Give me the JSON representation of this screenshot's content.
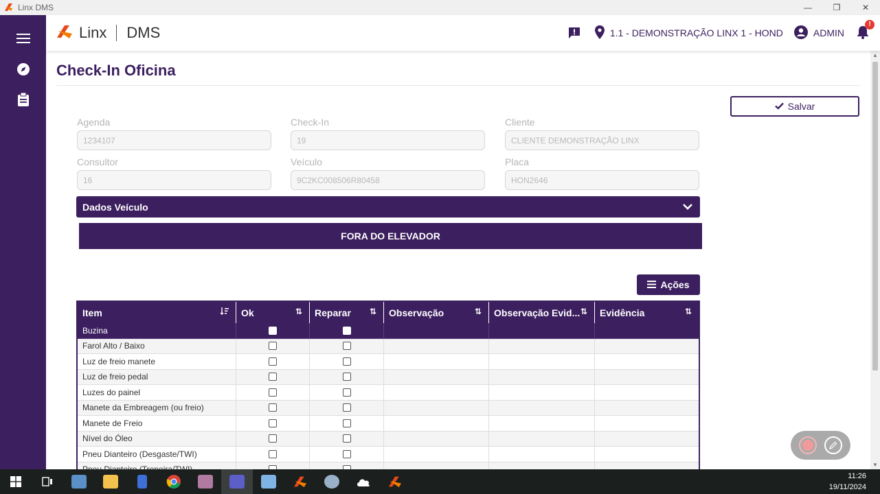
{
  "window": {
    "title": "Linx DMS",
    "controls": [
      "—",
      "❐",
      "✕"
    ]
  },
  "header": {
    "brand_name": "Linx",
    "brand_product": "DMS",
    "location": "1.1 - DEMONSTRAÇÃO LINX 1 - HOND",
    "user": "ADMIN",
    "notification_badge": "!"
  },
  "page": {
    "title": "Check-In Oficina",
    "save_label": "Salvar"
  },
  "fields": {
    "agenda": {
      "label": "Agenda",
      "value": "1234107"
    },
    "checkin": {
      "label": "Check-In",
      "value": "19"
    },
    "cliente": {
      "label": "Cliente",
      "value": "CLIENTE DEMONSTRAÇÃO LINX"
    },
    "consultor": {
      "label": "Consultor",
      "value": "16"
    },
    "veiculo": {
      "label": "Veículo",
      "value": "9C2KC008506R80458"
    },
    "placa": {
      "label": "Placa",
      "value": "HON2646"
    }
  },
  "sections": {
    "dados_veiculo": "Dados Veículo",
    "fora_elevador": "FORA DO ELEVADOR",
    "acoes": "Ações"
  },
  "table": {
    "columns": [
      "Item",
      "Ok",
      "Reparar",
      "Observação",
      "Observação Evid...",
      "Evidência"
    ],
    "rows": [
      "Buzina",
      "Farol Alto / Baixo",
      "Luz de freio manete",
      "Luz de freio pedal",
      "Luzes do painel",
      "Manete da Embreagem (ou freio)",
      "Manete de Freio",
      "Nível do Óleo",
      "Pneu Dianteiro (Desgaste/TWI)",
      "Pneu Dianteiro (Trepeira/TWI)"
    ]
  },
  "taskbar": {
    "time": "11:26",
    "date": "19/11/2024"
  },
  "colors": {
    "primary": "#3c1f5f",
    "accent": "#e64a19",
    "alert": "#e53935"
  }
}
